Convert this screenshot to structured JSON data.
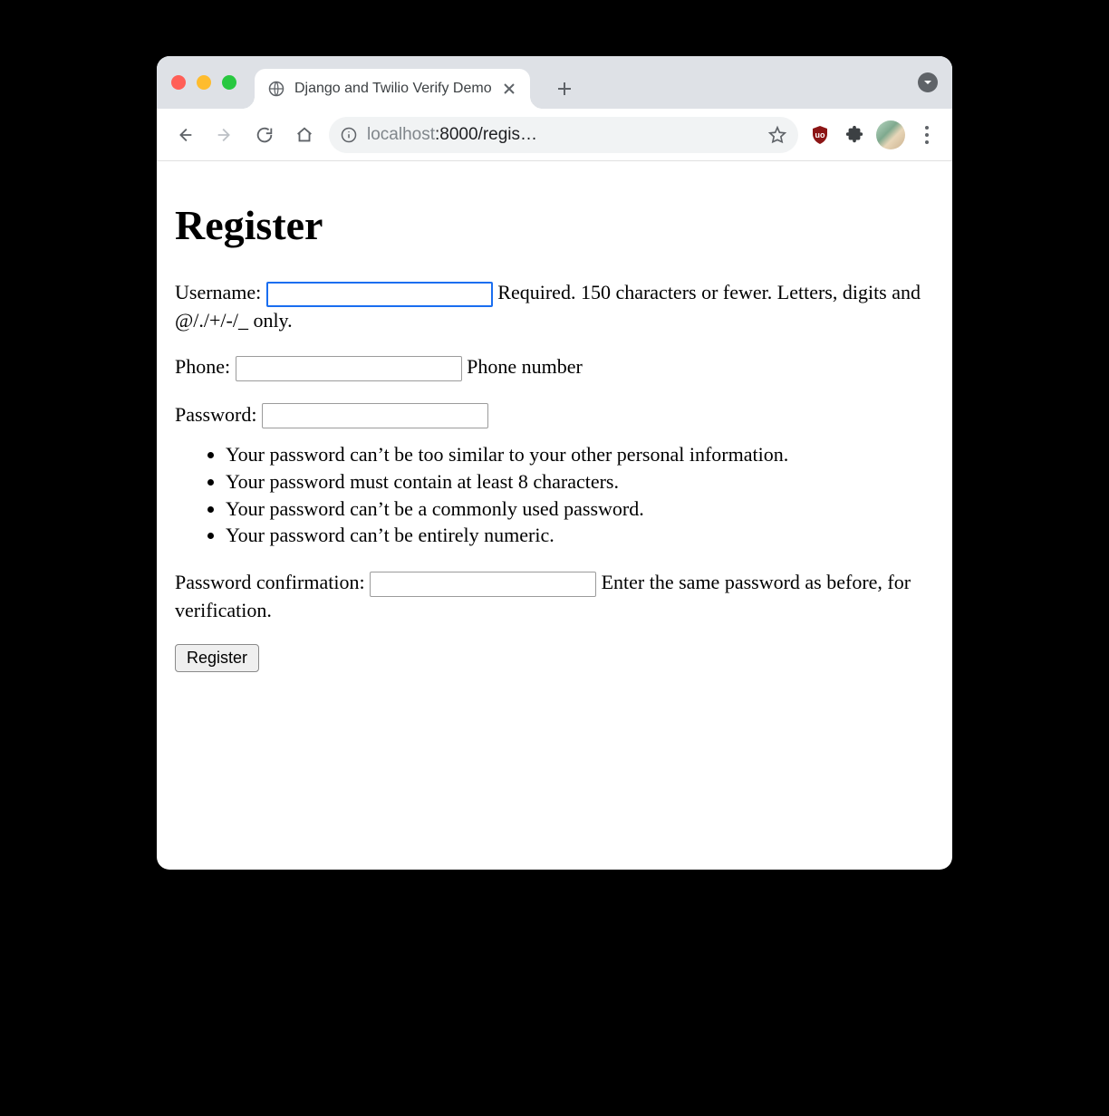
{
  "browser": {
    "tab": {
      "title": "Django and Twilio Verify Demo"
    },
    "omnibox": {
      "dim": "localhost",
      "rest": ":8000/regis…"
    }
  },
  "page": {
    "heading": "Register",
    "fields": {
      "username": {
        "label": "Username:",
        "value": "",
        "help": "Required. 150 characters or fewer. Letters, digits and @/./+/-/_ only."
      },
      "phone": {
        "label": "Phone:",
        "value": "",
        "help": "Phone number"
      },
      "password": {
        "label": "Password:",
        "value": "",
        "help_items": [
          "Your password can’t be too similar to your other personal information.",
          "Your password must contain at least 8 characters.",
          "Your password can’t be a commonly used password.",
          "Your password can’t be entirely numeric."
        ]
      },
      "password2": {
        "label": "Password confirmation:",
        "value": "",
        "help": "Enter the same password as before, for verification."
      }
    },
    "submit_label": "Register"
  }
}
